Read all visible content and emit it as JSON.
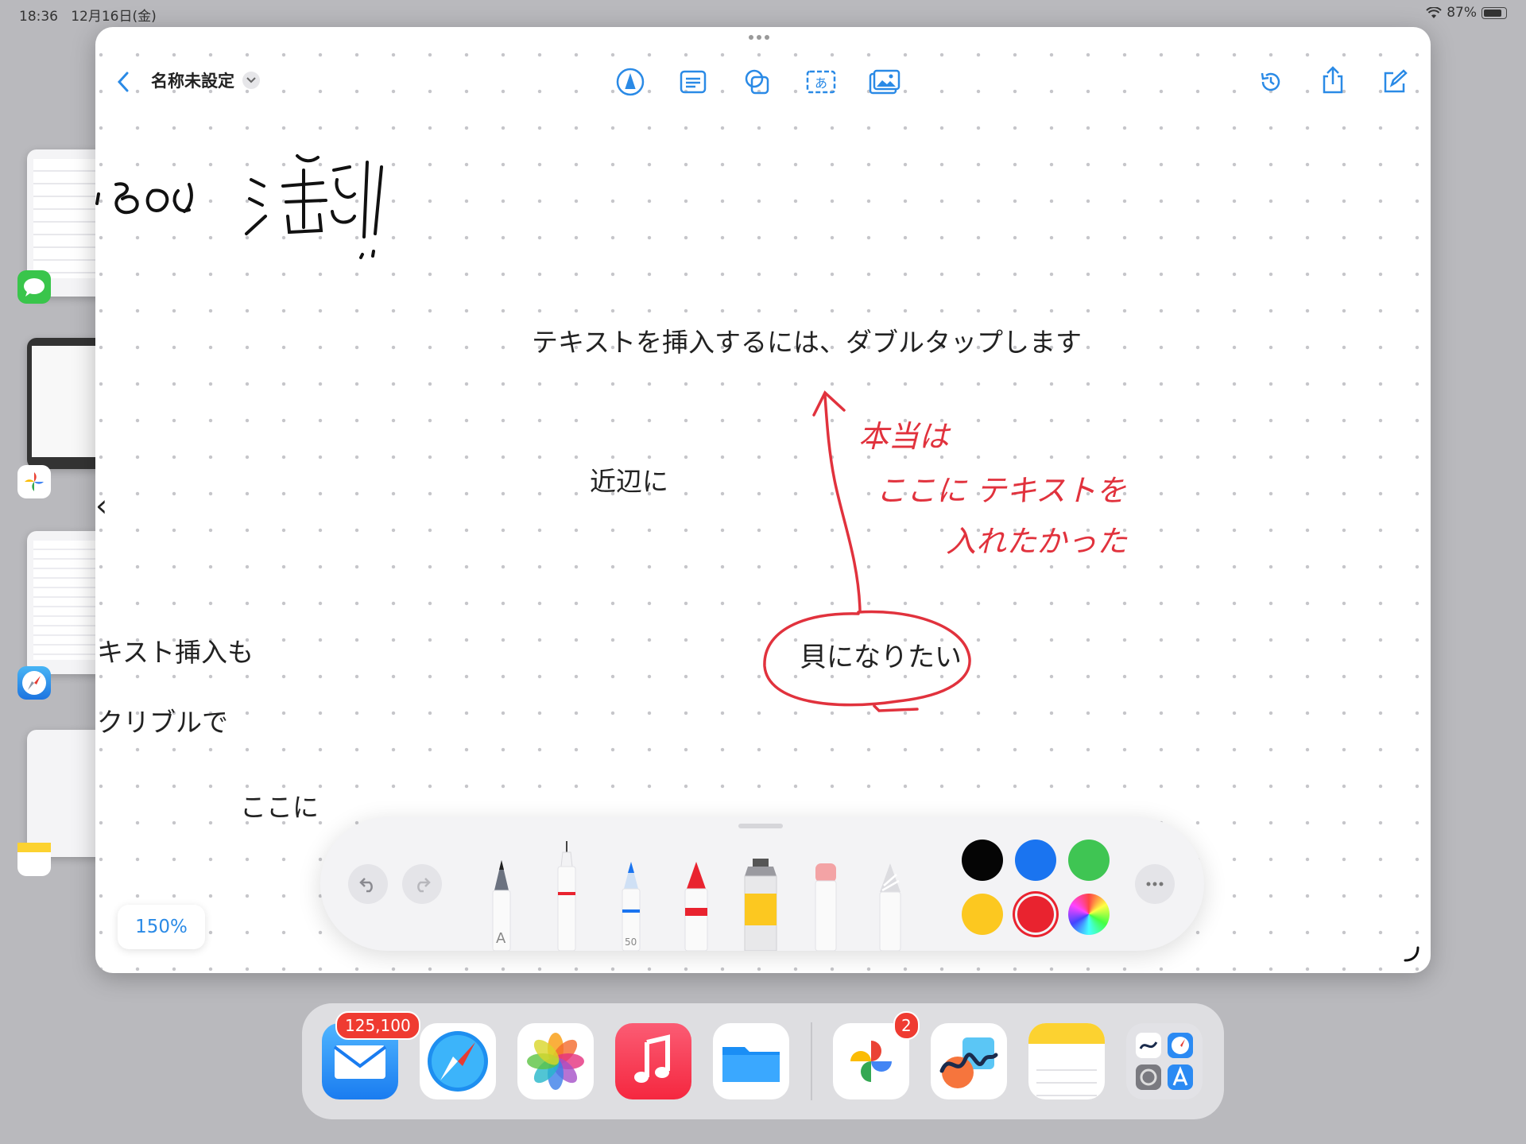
{
  "status_bar": {
    "time": "18:36",
    "date": "12月16日(金)",
    "battery": "87%"
  },
  "header": {
    "title": "名称未設定"
  },
  "canvas": {
    "handwriting_top": "なので 注意!!",
    "hint_text": "テキストを挿入するには、ダブルタップします",
    "text_nearby": "近辺に",
    "text_left_1": "キスト挿入も",
    "text_left_2": "クリブルで",
    "text_here": "ここに",
    "text_circled": "貝になりたい",
    "red_note_1": "本当は",
    "red_note_2": "ここに テキストを",
    "red_note_3": "入れたかった",
    "left_arrow": "‹"
  },
  "zoom": {
    "label": "150%"
  },
  "palette": {
    "marker_width": "50",
    "pen_letter": "A",
    "colors": [
      "#050505",
      "#1a74f0",
      "#3fc553",
      "#fcc820",
      "#e9232f"
    ],
    "selected_color": "#e9232f"
  },
  "dock": {
    "mail_badge": "125,100",
    "photos_badge": "2"
  },
  "icons": [
    "back-chevron-icon",
    "dropdown-chevron-icon",
    "pen-tool-icon",
    "text-box-icon",
    "shapes-icon",
    "text-insert-icon",
    "image-icon",
    "history-icon",
    "share-icon",
    "compose-icon",
    "undo-icon",
    "redo-icon",
    "more-icon"
  ]
}
